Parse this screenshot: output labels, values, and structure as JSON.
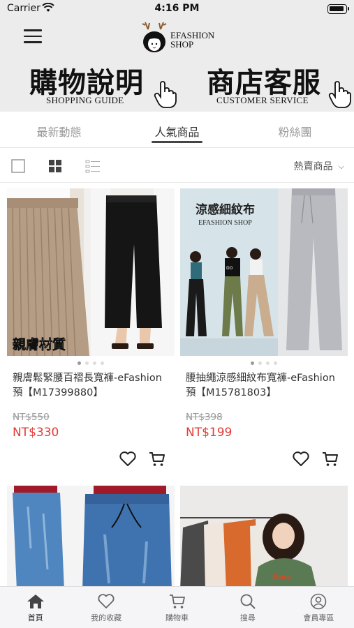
{
  "status_bar": {
    "carrier": "Carrier",
    "time": "4:16 PM"
  },
  "header": {
    "logo_text_line1": "EFASHION",
    "logo_text_line2": "SHOP",
    "banners": [
      {
        "main": "購物說明",
        "sub": "SHOPPING GUIDE"
      },
      {
        "main": "商店客服",
        "sub": "CUSTOMER SERVICE"
      }
    ]
  },
  "tabs": [
    {
      "label": "最新動態",
      "active": false
    },
    {
      "label": "人氣商品",
      "active": true
    },
    {
      "label": "粉絲團",
      "active": false
    }
  ],
  "toolbar": {
    "sort_label": "熱賣商品"
  },
  "products": [
    {
      "image_overlay": "親膚材質",
      "title": "親膚鬆緊腰百褶長寬褲-eFashion 預【M17399880】",
      "old_price": "NT$550",
      "price": "NT$330"
    },
    {
      "image_overlay": "涼感細紋布",
      "image_overlay_sub": "EFASHION SHOP",
      "title": "腰抽繩涼感細紋布寬褲-eFashion 預【M15781803】",
      "old_price": "NT$398",
      "price": "NT$199"
    }
  ],
  "bottom_nav": [
    {
      "label": "首頁",
      "icon": "home-icon",
      "active": true
    },
    {
      "label": "我的收藏",
      "icon": "heart-icon",
      "active": false
    },
    {
      "label": "購物車",
      "icon": "cart-icon",
      "active": false
    },
    {
      "label": "搜尋",
      "icon": "search-icon",
      "active": false
    },
    {
      "label": "會員專區",
      "icon": "user-icon",
      "active": false
    }
  ],
  "colors": {
    "price": "#e53935",
    "header_bg": "#ececec"
  }
}
